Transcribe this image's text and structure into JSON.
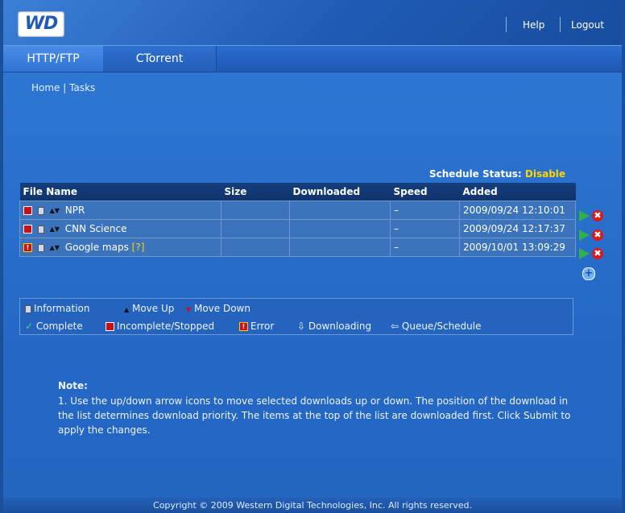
{
  "logo_text": "WD",
  "header": {
    "help": "Help",
    "logout": "Logout"
  },
  "tabs": [
    {
      "label": "HTTP/FTP",
      "active": true
    },
    {
      "label": "CTorrent",
      "active": false
    }
  ],
  "breadcrumb": {
    "home": "Home",
    "separator": "|",
    "tasks": "Tasks"
  },
  "schedule": {
    "label": "Schedule Status:",
    "value": "Disable"
  },
  "table": {
    "columns": [
      "File Name",
      "Size",
      "Downloaded",
      "Speed",
      "Added"
    ],
    "rows": [
      {
        "status": "stopped",
        "name": "NPR",
        "size": "",
        "downloaded": "",
        "speed": "–",
        "added": "2009/09/24 12:10:01",
        "extra": ""
      },
      {
        "status": "stopped",
        "name": "CNN Science",
        "size": "",
        "downloaded": "",
        "speed": "–",
        "added": "2009/09/24 12:17:37",
        "extra": ""
      },
      {
        "status": "error",
        "name": "Google maps",
        "size": "",
        "downloaded": "",
        "speed": "–",
        "added": "2009/10/01 13:09:29",
        "extra": "[?]"
      }
    ]
  },
  "legend": {
    "information": "Information",
    "move_up": "Move Up",
    "move_down": "Move Down",
    "complete": "Complete",
    "incomplete": "Incomplete/Stopped",
    "error": "Error",
    "downloading": "Downloading",
    "queue": "Queue/Schedule"
  },
  "note": {
    "title": "Note:",
    "items": [
      "1.  Use the up/down arrow icons to move selected downloads up or down. The position of the download in the list determines download priority. The items at the top of the list are downloaded first. Click Submit to apply the changes."
    ]
  },
  "footer": "Copyright © 2009 Western Digital Technologies, Inc. All rights reserved.",
  "colors": {
    "accent": "#2467c4",
    "schedule_value": "#ffd400",
    "stop": "#c8101a",
    "play": "#32b04a"
  }
}
